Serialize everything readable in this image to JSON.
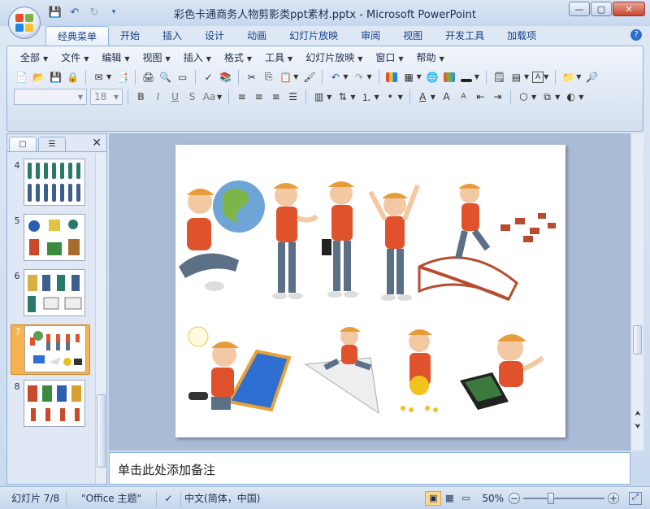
{
  "window": {
    "title": "彩色卡通商务人物剪影类ppt素材.pptx - Microsoft PowerPoint",
    "controls": {
      "minimize": "—",
      "maximize": "▢",
      "close": "✕"
    }
  },
  "ribbon_tabs": [
    "经典菜单",
    "开始",
    "插入",
    "设计",
    "动画",
    "幻灯片放映",
    "审阅",
    "视图",
    "开发工具",
    "加载项"
  ],
  "menu": [
    "全部",
    "文件",
    "编辑",
    "视图",
    "插入",
    "格式",
    "工具",
    "幻灯片放映",
    "窗口",
    "帮助"
  ],
  "format_bar": {
    "font_size": "18",
    "bold": "B",
    "italic": "I",
    "underline": "U",
    "shadow": "S",
    "case": "Aa"
  },
  "slides_panel": {
    "thumbnails": [
      {
        "num": "4"
      },
      {
        "num": "5"
      },
      {
        "num": "6"
      },
      {
        "num": "7"
      },
      {
        "num": "8"
      }
    ]
  },
  "notes": {
    "placeholder": "单击此处添加备注"
  },
  "status": {
    "slide_info": "幻灯片 7/8",
    "theme": "\"Office 主题\"",
    "language": "中文(简体，中国)",
    "zoom": "50%"
  },
  "colors": {
    "accent": "#f6b150",
    "ribbon_border": "#8db2e3",
    "shirt": "#e0522b",
    "cap": "#e89b3a",
    "pants": "#5b6f86"
  }
}
